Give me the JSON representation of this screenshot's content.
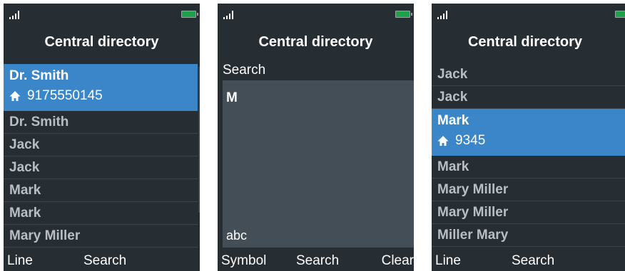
{
  "screens": [
    {
      "title": "Central directory",
      "selected": {
        "name": "Dr. Smith",
        "number": "9175550145",
        "icon": "home-icon"
      },
      "items": [
        "Dr. Smith",
        "Jack",
        "Jack",
        "Mark",
        "Mark",
        "Mary Miller"
      ],
      "softkeys": {
        "left": "Line",
        "center": "Search"
      }
    },
    {
      "title": "Central directory",
      "search_label": "Search",
      "search_value": "M",
      "input_mode": "abc",
      "softkeys": {
        "left": "Symbol",
        "center": "Search",
        "right": "Clear"
      }
    },
    {
      "title": "Central directory",
      "items_before": [
        "Jack",
        "Jack"
      ],
      "selected": {
        "name": "Mark",
        "number": "9345",
        "icon": "home-icon"
      },
      "items_after": [
        "Mark",
        "Mary Miller",
        "Mary Miller",
        "Miller Mary"
      ],
      "softkeys": {
        "left": "Line",
        "center": "Search"
      }
    }
  ],
  "colors": {
    "background": "#262d33",
    "selection": "#3b86c9",
    "battery": "#1fa04a",
    "search_box": "#434e57"
  }
}
